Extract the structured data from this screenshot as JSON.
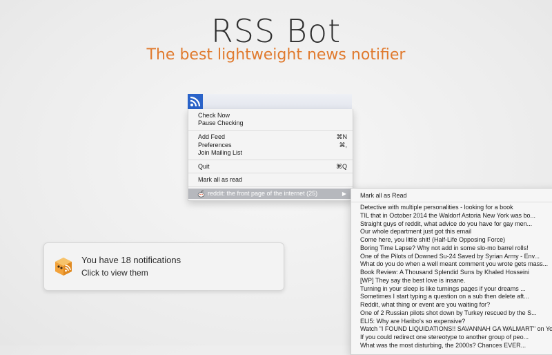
{
  "hero": {
    "title": "RSS Bot",
    "subtitle": "The best lightweight news notifier"
  },
  "menubar": {
    "icon": "rss-icon"
  },
  "menu": {
    "check_now": "Check Now",
    "pause_checking": "Pause Checking",
    "add_feed": "Add Feed",
    "add_feed_shortcut": "⌘N",
    "preferences": "Preferences",
    "preferences_shortcut": "⌘,",
    "join_mailing_list": "Join Mailing List",
    "quit": "Quit",
    "quit_shortcut": "⌘Q",
    "mark_all_as_read": "Mark all as read",
    "feed_item": "reddit: the front page of the internet (25)"
  },
  "submenu": {
    "mark_all": "Mark all as Read",
    "items": [
      "Detective with multiple personalities - looking for a book",
      "TIL that in October 2014 the Waldorf Astoria New York was bo...",
      "Straight guys of reddit, what advice do you have for gay men...",
      "Our whole department just got this email",
      "Come here, you little shit! (Half-Life Opposing Force)",
      "Boring Time Lapse? Why not add in some slo-mo barrel rolls!",
      "One of the Pilots of Downed Su-24 Saved by Syrian Army - Env...",
      "What do you do when a well meant comment you wrote gets mass...",
      "Book Review: A Thousand Splendid Suns by Khaled Hosseini",
      "[WP] They say the best love is insane.",
      "Turning in your sleep is like turnings pages if your dreams ...",
      "Sometimes I start typing a question on a sub then delete aft...",
      "Reddit, what thing or event are you waiting for?",
      "One of 2 Russian pilots shot down by Turkey rescued by the S...",
      "ELI5: Why are Haribo's so expensive?",
      "Watch \"I FOUND LIQUIDATIONS!! SAVANNAH GA WALMART\" on Yo...",
      "If you could redirect one stereotype to another group of peo...",
      "What was the most disturbing, the 2000s? Chances EVER..."
    ]
  },
  "notification": {
    "title": "You have 18 notifications",
    "body": "Click to view them",
    "icon": "rss-bot-cube-icon"
  },
  "colors": {
    "accent": "#e07a2e",
    "rss_blue": "#2a63c9",
    "highlight": "#b6b8bd"
  }
}
